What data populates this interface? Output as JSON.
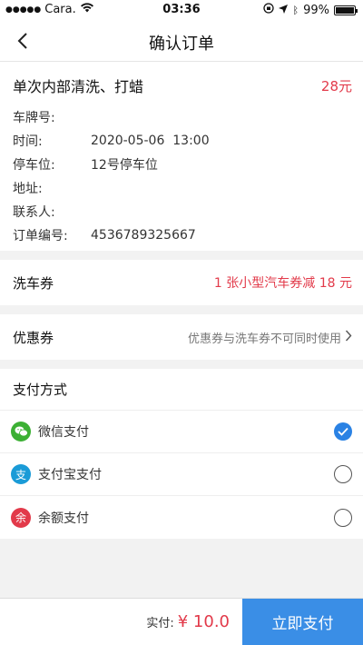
{
  "status": {
    "carrier": "Cara.",
    "time": "03:36",
    "battery": "99%",
    "battery_level": 0.99
  },
  "nav": {
    "title": "确认订单"
  },
  "order": {
    "name": "单次内部清洗、打蜡",
    "price": "28元",
    "rows": [
      {
        "label": "车牌号:",
        "value": ""
      },
      {
        "label": "时间:",
        "value": "2020-05-06  13:00"
      },
      {
        "label": "停车位:",
        "value": "12号停车位"
      },
      {
        "label": "地址:",
        "value": ""
      },
      {
        "label": "联系人:",
        "value": ""
      },
      {
        "label": "订单编号:",
        "value": "4536789325667"
      }
    ]
  },
  "wash_coupon": {
    "label": "洗车券",
    "value": "1 张小型汽车券减 18 元"
  },
  "discount_coupon": {
    "label": "优惠券",
    "value": "优惠券与洗车券不可同时使用"
  },
  "payment": {
    "title": "支付方式",
    "methods": [
      {
        "label": "微信支付",
        "icon_char": "",
        "icon": "wechat-icon",
        "color": "#3cb034",
        "selected": true
      },
      {
        "label": "支付宝支付",
        "icon_char": "支",
        "icon": "alipay-icon",
        "color": "#1a9bd7",
        "selected": false
      },
      {
        "label": "余额支付",
        "icon_char": "余",
        "icon": "balance-icon",
        "color": "#e23a4a",
        "selected": false
      }
    ]
  },
  "footer": {
    "total_label": "实付:",
    "total_amount": "¥ 10.0",
    "pay_button": "立即支付"
  },
  "colors": {
    "accent": "#3a8ee6",
    "price_red": "#e23a4a"
  }
}
